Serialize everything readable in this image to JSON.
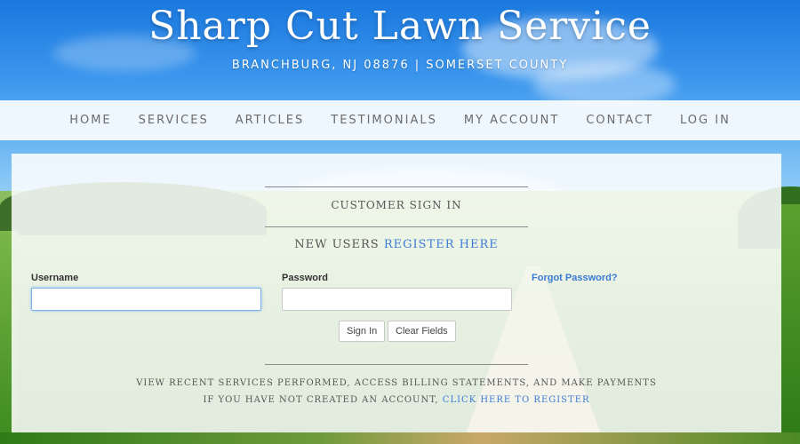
{
  "header": {
    "title": "Sharp Cut Lawn Service",
    "tagline": "BRANCHBURG, NJ 08876 | SOMERSET COUNTY"
  },
  "nav": {
    "items": [
      "HOME",
      "SERVICES",
      "ARTICLES",
      "TESTIMONIALS",
      "MY ACCOUNT",
      "CONTACT",
      "LOG IN"
    ]
  },
  "signin": {
    "heading": "CUSTOMER SIGN IN",
    "new_users_prefix": "NEW USERS ",
    "register_link": "REGISTER HERE",
    "username_label": "Username",
    "username_value": "",
    "password_label": "Password",
    "password_value": "",
    "forgot_link": "Forgot Password?",
    "signin_button": "Sign In",
    "clear_button": "Clear Fields",
    "info_line": "VIEW RECENT SERVICES PERFORMED, ACCESS BILLING STATEMENTS, AND MAKE PAYMENTS",
    "register_prefix": "IF YOU HAVE NOT CREATED AN ACCOUNT, ",
    "register_click_link": "CLICK HERE TO REGISTER"
  },
  "colors": {
    "link": "#3a7bd5",
    "nav_text": "#6b6b6b",
    "sky": "#1a78de"
  }
}
